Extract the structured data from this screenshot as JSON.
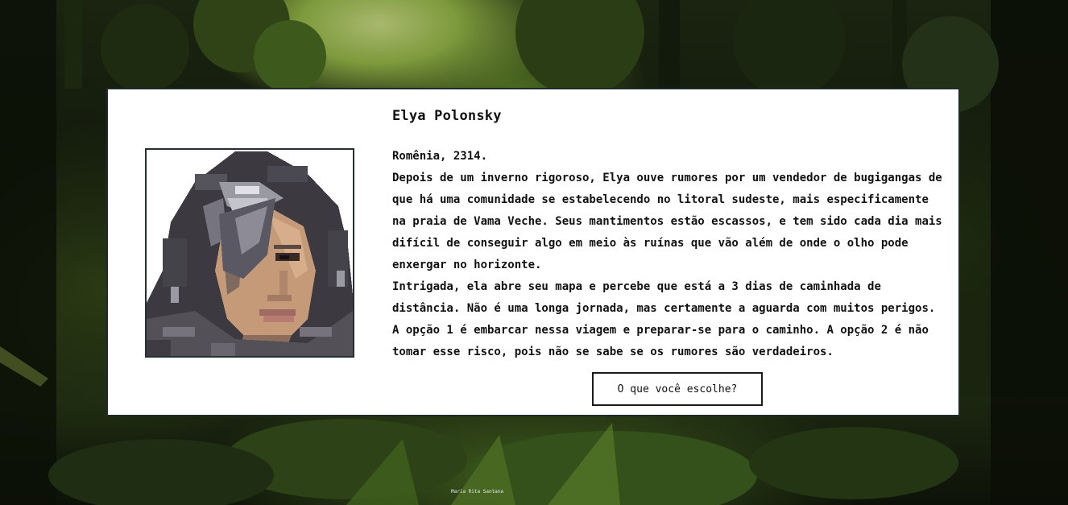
{
  "character": {
    "name": "Elya Polonsky",
    "portrait_icon": "pixel-art-portrait"
  },
  "story": {
    "location_date": "Romênia, 2314.",
    "paragraph_1": "Depois de um inverno rigoroso, Elya ouve rumores por um vendedor de bugigangas de que há uma comunidade se estabelecendo no litoral sudeste, mais especificamente na praia de Vama Veche. Seus mantimentos estão escassos, e tem sido cada dia mais difícil de conseguir algo em meio às ruínas que vão além de onde o olho pode enxergar no horizonte.",
    "paragraph_2": "Intrigada, ela abre seu mapa e percebe que está a 3 dias de caminhada de distância. Não é uma longa jornada, mas certamente a aguarda com muitos perigos. A opção 1 é embarcar nessa viagem e preparar-se para o caminho. A opção 2 é não tomar esse risco, pois não se sabe se os rumores são verdadeiros."
  },
  "choice": {
    "button_label": "O que você escolhe?"
  },
  "footer": {
    "credit": "Maria Rita Santana"
  },
  "colors": {
    "panel_background": "#ffffff",
    "panel_border": "#1f2a2a",
    "text": "#111111",
    "forest_dark": "#10160a",
    "forest_light": "#7d9a3c"
  }
}
